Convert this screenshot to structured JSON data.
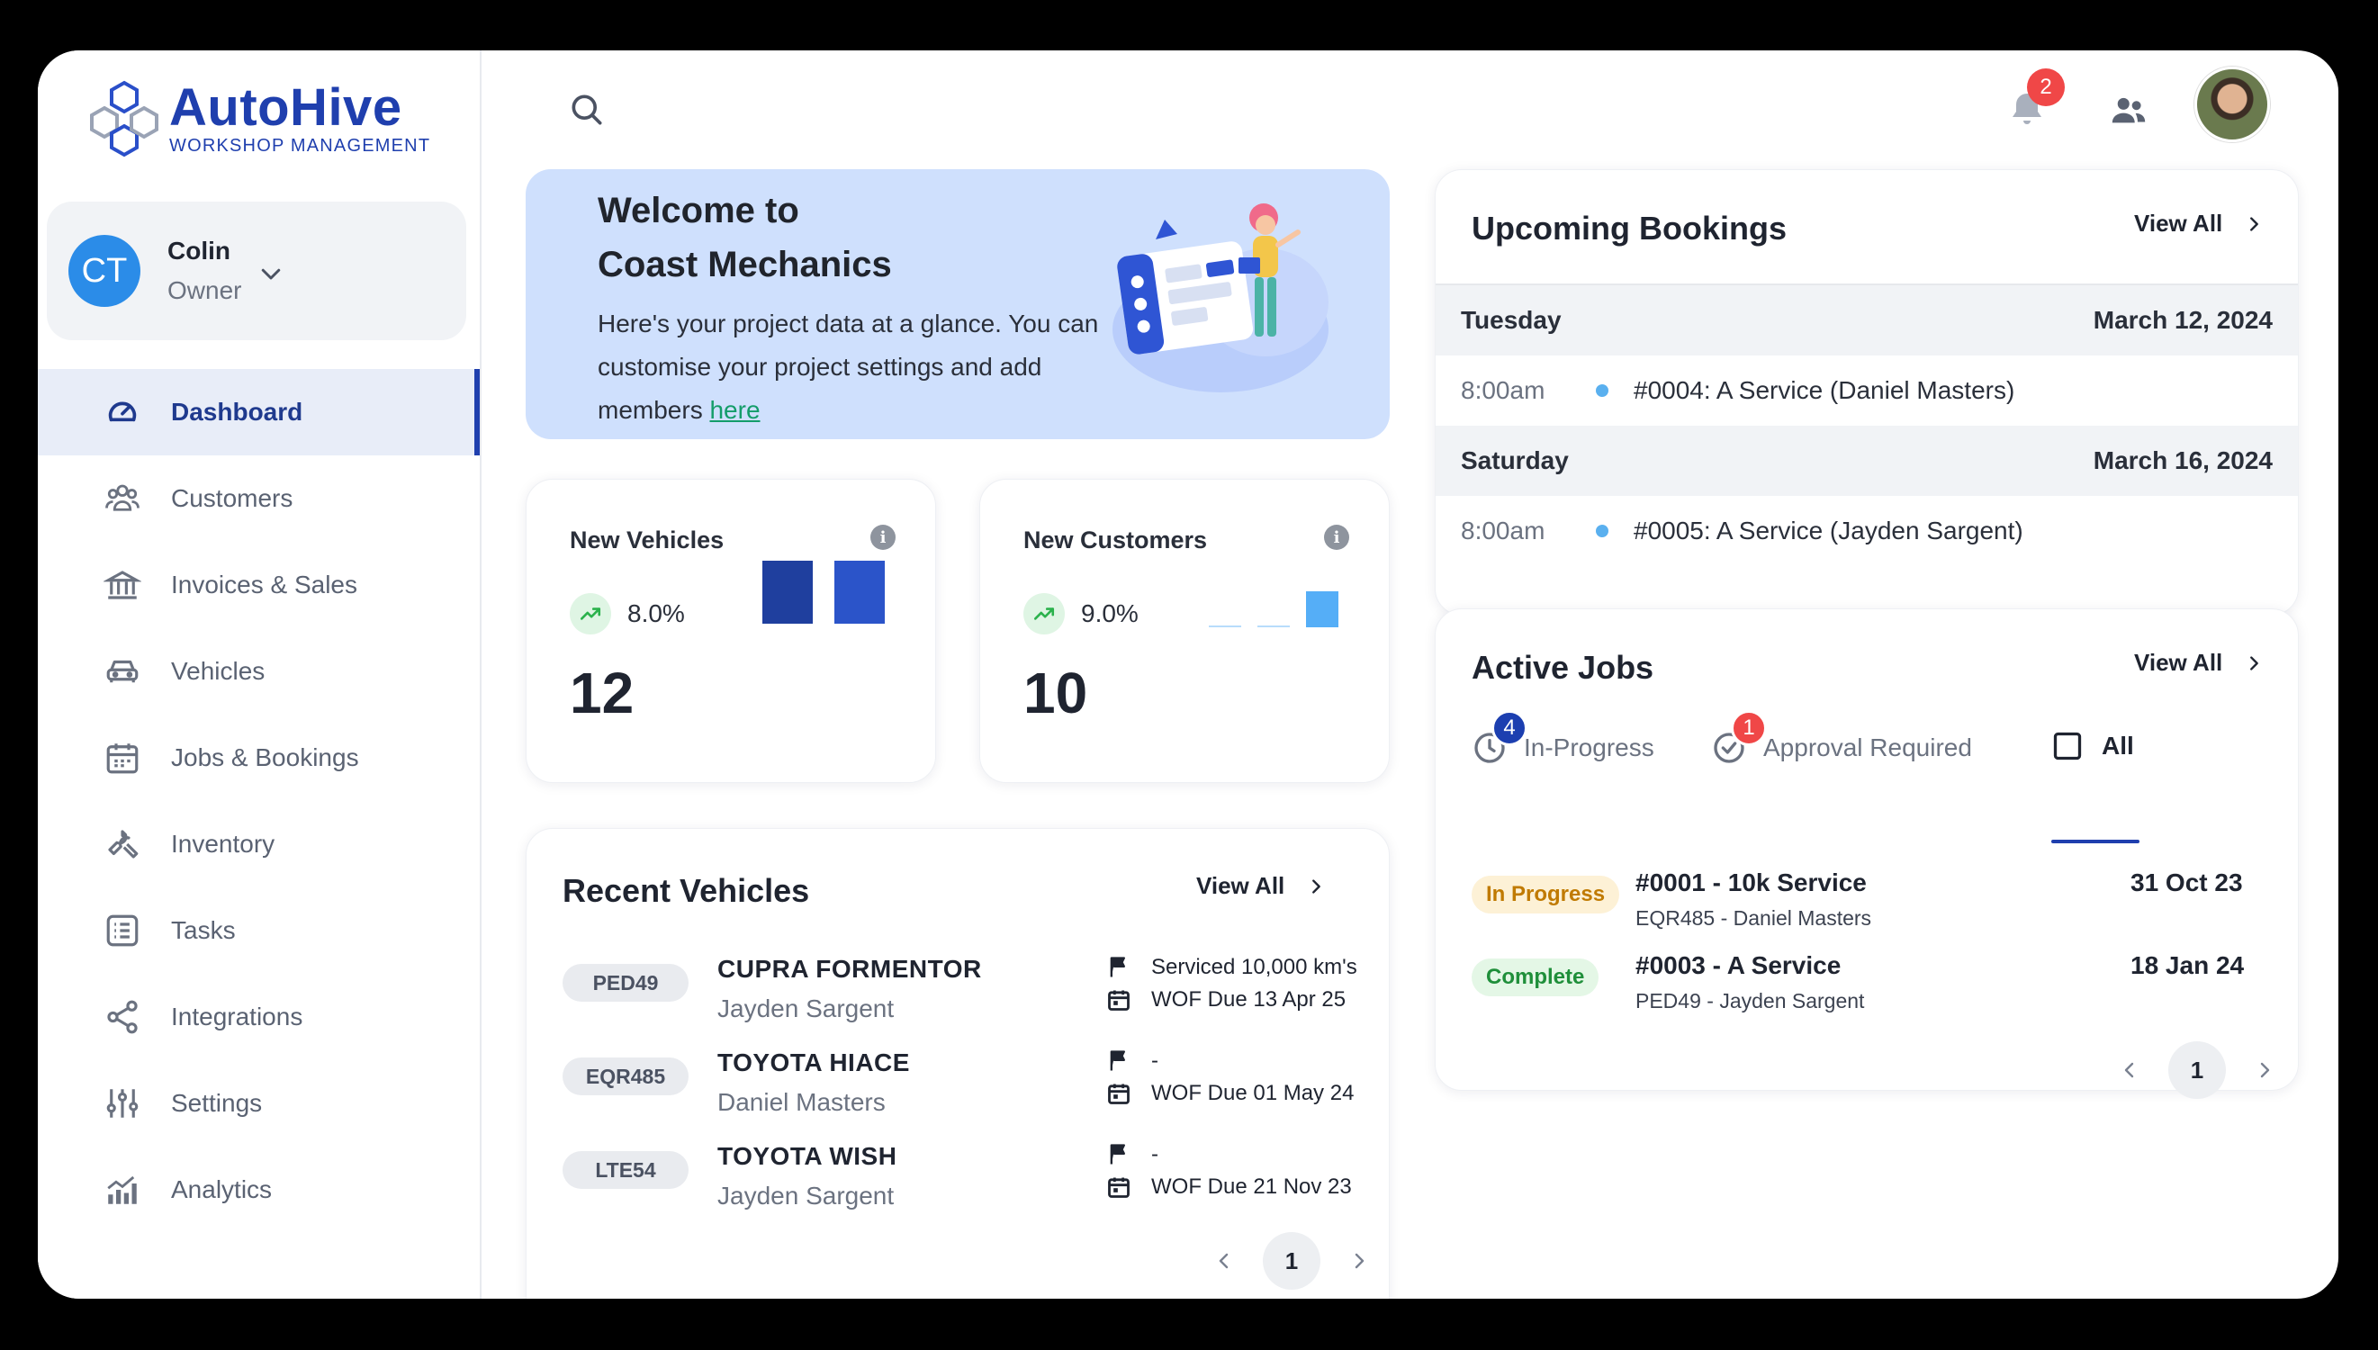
{
  "brand": {
    "name": "AutoHive",
    "subtitle": "WORKSHOP MANAGEMENT"
  },
  "user": {
    "initials": "CT",
    "name": "Colin",
    "role": "Owner"
  },
  "nav": {
    "items": [
      {
        "label": "Dashboard",
        "icon": "gauge-icon",
        "active": true
      },
      {
        "label": "Customers",
        "icon": "users-group-icon"
      },
      {
        "label": "Invoices & Sales",
        "icon": "bank-icon"
      },
      {
        "label": "Vehicles",
        "icon": "car-icon"
      },
      {
        "label": "Jobs & Bookings",
        "icon": "calendar-icon"
      },
      {
        "label": "Inventory",
        "icon": "wrench-icon"
      },
      {
        "label": "Tasks",
        "icon": "checklist-icon"
      },
      {
        "label": "Integrations",
        "icon": "share-icon"
      },
      {
        "label": "Settings",
        "icon": "sliders-icon"
      },
      {
        "label": "Analytics",
        "icon": "chart-icon"
      }
    ]
  },
  "header": {
    "notifications_count": "2"
  },
  "welcome": {
    "title_line1": "Welcome to",
    "title_line2": "Coast Mechanics",
    "body": "Here's your project data at a glance. You can customise your project settings and add members ",
    "link": "here"
  },
  "stats": {
    "new_vehicles": {
      "title": "New Vehicles",
      "change": "8.0%",
      "value": "12",
      "bars": [
        0.78,
        0.78
      ],
      "bar_colors": [
        "#1f3f9e",
        "#2b54c9"
      ]
    },
    "new_customers": {
      "title": "New Customers",
      "change": "9.0%",
      "value": "10",
      "bars": [
        0.02,
        0.02,
        0.65
      ],
      "bar_colors": [
        "#b8dcfb",
        "#b8dcfb",
        "#55aef7"
      ]
    }
  },
  "bookings": {
    "title": "Upcoming Bookings",
    "view_all": "View All",
    "days": [
      {
        "day": "Tuesday",
        "date": "March 12, 2024",
        "time": "8:00am",
        "item": "#0004: A Service (Daniel Masters)"
      },
      {
        "day": "Saturday",
        "date": "March 16, 2024",
        "time": "8:00am",
        "item": "#0005: A Service (Jayden Sargent)"
      }
    ]
  },
  "jobs": {
    "title": "Active Jobs",
    "view_all": "View All",
    "tabs": [
      {
        "label": "In-Progress",
        "badge": "4"
      },
      {
        "label": "Approval Required",
        "badge": "1"
      },
      {
        "label": "All"
      }
    ],
    "rows": [
      {
        "status": "In Progress",
        "title": "#0001 - 10k Service",
        "sub": "EQR485 - Daniel Masters",
        "date": "31 Oct 23"
      },
      {
        "status": "Complete",
        "title": "#0003 - A Service",
        "sub": "PED49 - Jayden Sargent",
        "date": "18 Jan 24"
      }
    ],
    "page": "1"
  },
  "recent_vehicles": {
    "title": "Recent Vehicles",
    "view_all": "View All",
    "rows": [
      {
        "plate": "PED49",
        "name": "CUPRA FORMENTOR",
        "owner": "Jayden Sargent",
        "service": "Serviced 10,000 km's",
        "wof": "WOF Due 13 Apr 25"
      },
      {
        "plate": "EQR485",
        "name": "TOYOTA HIACE",
        "owner": "Daniel Masters",
        "service": "-",
        "wof": "WOF Due 01 May 24"
      },
      {
        "plate": "LTE54",
        "name": "TOYOTA WISH",
        "owner": "Jayden Sargent",
        "service": "-",
        "wof": "WOF Due 21 Nov 23"
      }
    ],
    "page": "1"
  },
  "colors": {
    "accent": "#1f3fae",
    "badge_red": "#f04747",
    "badge_blue": "#1c3fb0",
    "welcome_bg": "#cfe0fd"
  }
}
